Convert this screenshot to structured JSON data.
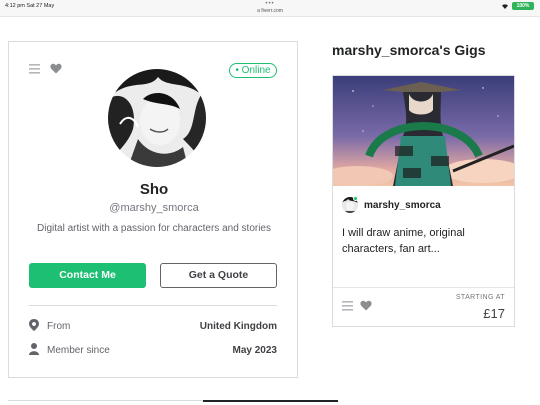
{
  "statusbar": {
    "time": "4:12 pm   Sat 27 May",
    "dots": "•••",
    "url": "a fiverr.com",
    "battery": "100%"
  },
  "profile": {
    "status_badge": "• Online",
    "display_name": "Sho",
    "username": "@marshy_smorca",
    "tagline": "Digital artist with a passion for characters and stories",
    "contact_button": "Contact Me",
    "quote_button": "Get a Quote",
    "info": [
      {
        "label": "From",
        "value": "United Kingdom",
        "icon": "location-pin-icon"
      },
      {
        "label": "Member since",
        "value": "May 2023",
        "icon": "person-icon"
      }
    ]
  },
  "gigs": {
    "title": "marshy_smorca's Gigs",
    "items": [
      {
        "seller_name": "marshy_smorca",
        "description": "I will draw anime, original characters, fan art...",
        "starting_at_label": "STARTING AT",
        "price": "£17"
      }
    ]
  },
  "colors": {
    "accent": "#1dbf73",
    "text": "#404145",
    "border": "#dadbdd"
  }
}
